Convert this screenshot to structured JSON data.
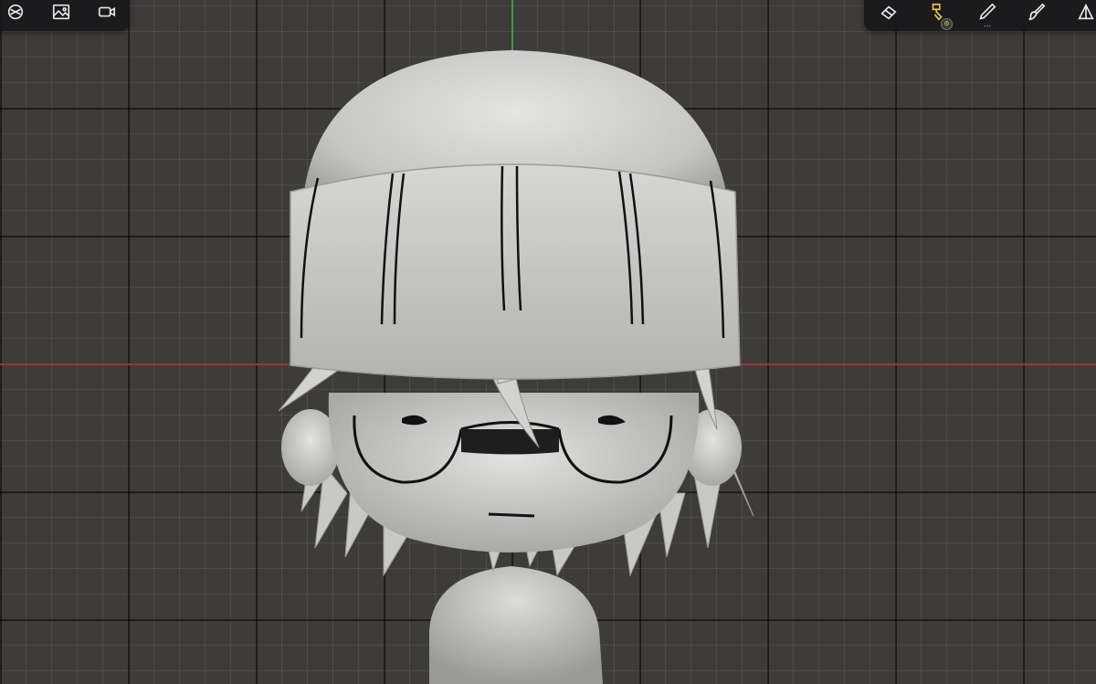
{
  "toolbar_left": {
    "tools": [
      {
        "name": "render-icon"
      },
      {
        "name": "image-icon"
      },
      {
        "name": "video-icon"
      }
    ]
  },
  "toolbar_right": {
    "tools": [
      {
        "name": "eraser-icon"
      },
      {
        "name": "paint-brush-icon",
        "active": true,
        "accent": "#e6c64a",
        "badge_icon": "gear-icon"
      },
      {
        "name": "pen-icon",
        "more": "..."
      },
      {
        "name": "brush-icon"
      },
      {
        "name": "layers-icon"
      }
    ]
  },
  "viewport": {
    "background": "#3e3c3a",
    "axis_x_color": "#b0393a",
    "axis_y_color": "#4fa04a"
  }
}
